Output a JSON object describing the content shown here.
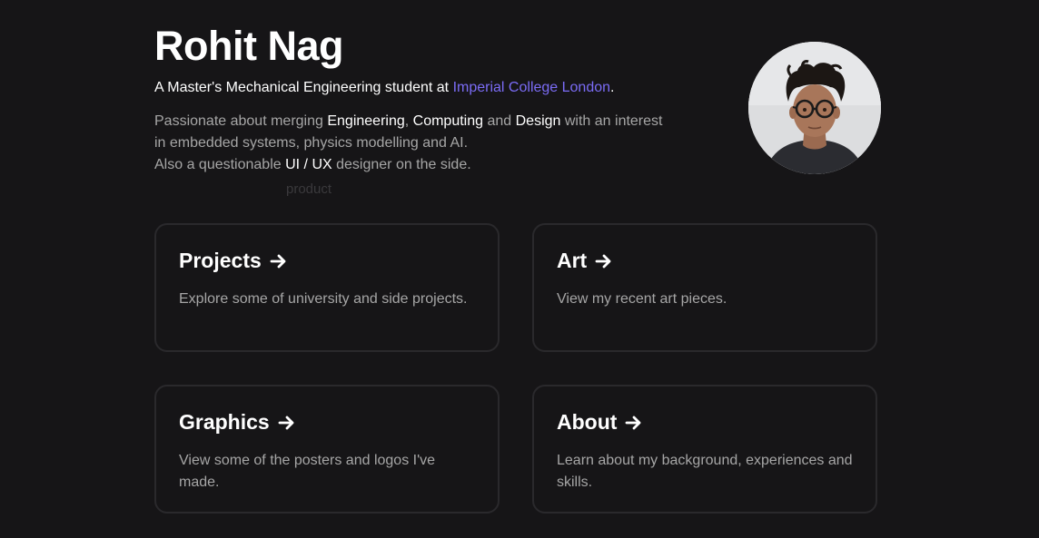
{
  "profile": {
    "name": "Rohit Nag",
    "tagline_prefix": "A Master's Mechanical Engineering student at ",
    "tagline_link": "Imperial College London",
    "tagline_suffix": ".",
    "bio": {
      "p1": "Passionate about merging ",
      "w1": "Engineering",
      "p2": ", ",
      "w2": "Computing",
      "p3": " and ",
      "w3": "Design",
      "p4": " with an interest in embedded systems, physics modelling and AI.",
      "p5": "Also a questionable ",
      "w4": "UI / UX",
      "p6": " designer on the side."
    },
    "ghost_word": "product"
  },
  "cards": [
    {
      "title": "Projects",
      "desc": "Explore some of university and side projects."
    },
    {
      "title": "Art",
      "desc": "View my recent art pieces."
    },
    {
      "title": "Graphics",
      "desc": "View some of the posters and logos I've made."
    },
    {
      "title": "About",
      "desc": "Learn about my background, experiences and skills."
    }
  ],
  "colors": {
    "background": "#161517",
    "accent_link": "#7b6cf6",
    "muted_text": "#a6a6a6",
    "card_border": "#2a292c"
  },
  "icons": {
    "card_arrow": "arrow-right-icon"
  }
}
